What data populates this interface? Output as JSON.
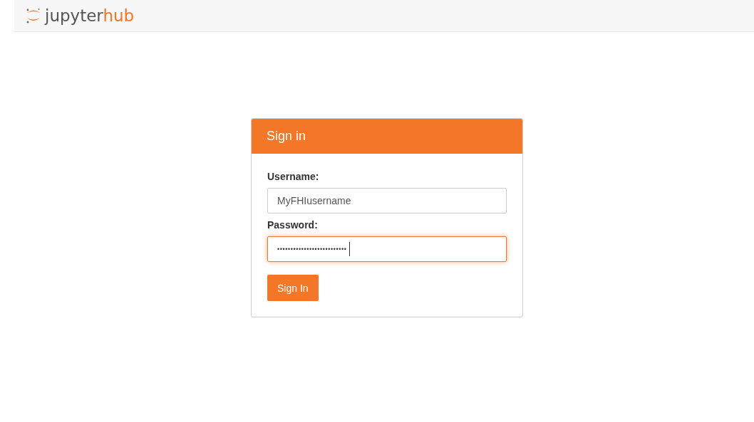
{
  "header": {
    "logo": {
      "name": "jupyter",
      "suffix": "hub"
    }
  },
  "login": {
    "title": "Sign in",
    "fields": [
      {
        "label": "Username:",
        "value": "MyFHIusername",
        "focused": false
      },
      {
        "label": "Password:",
        "value": "••••••••••••••••••••••••••",
        "focused": true
      }
    ],
    "button": "Sign In"
  }
}
